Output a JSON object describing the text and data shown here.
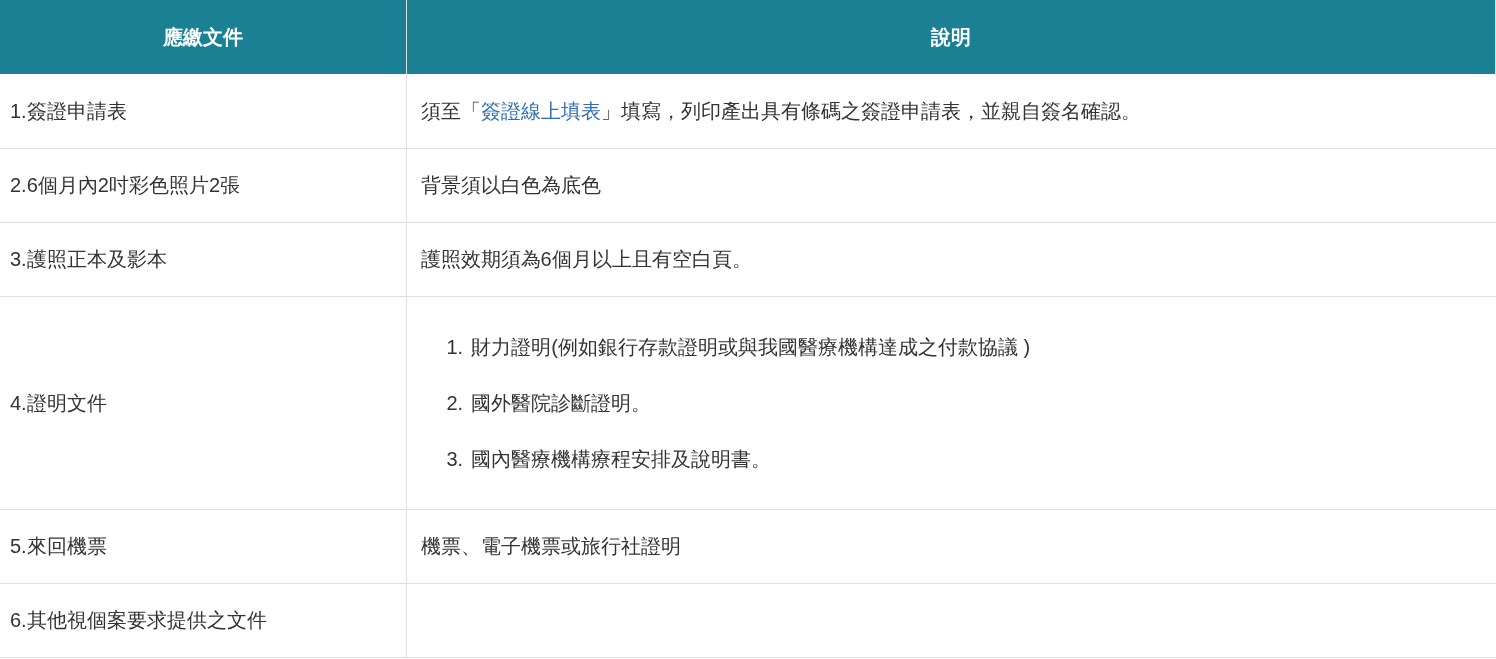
{
  "table": {
    "columns": [
      "應繳文件",
      "說明"
    ],
    "rows": [
      {
        "kind": "link",
        "document": "1.簽證申請表",
        "before": "須至「",
        "link": "簽證線上填表",
        "after": "」填寫，列印產出具有條碼之簽證申請表，並親自簽名確認。"
      },
      {
        "kind": "text",
        "document": "2.6個月內2吋彩色照片2張",
        "description": "背景須以白色為底色"
      },
      {
        "kind": "text",
        "document": "3.護照正本及影本",
        "description": "護照效期須為6個月以上且有空白頁。"
      },
      {
        "kind": "list",
        "document": "4.證明文件",
        "items": [
          {
            "number": "1.",
            "text": "財力證明(例如銀行存款證明或與我國醫療機構達成之付款協議 )"
          },
          {
            "number": "2.",
            "text": "國外醫院診斷證明。"
          },
          {
            "number": "3.",
            "text": "國內醫療機構療程安排及說明書。"
          }
        ]
      },
      {
        "kind": "text",
        "document": "5.來回機票",
        "description": "機票、電子機票或旅行社證明"
      },
      {
        "kind": "empty",
        "document": "6.其他視個案要求提供之文件"
      }
    ]
  }
}
